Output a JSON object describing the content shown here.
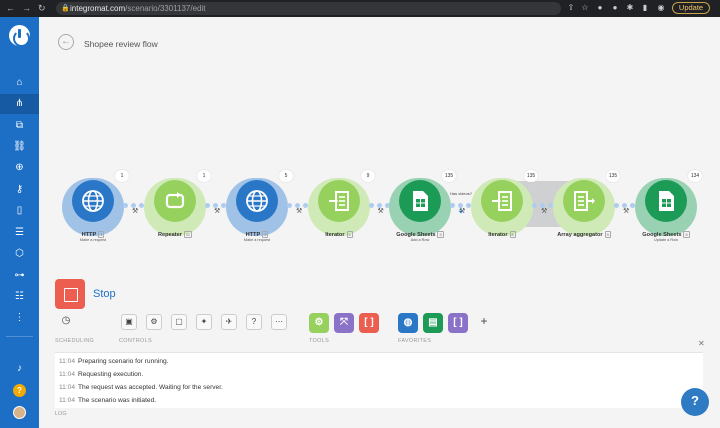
{
  "browser": {
    "url_host": "integromat.com",
    "url_path": "/scenario/3301137/edit",
    "update_label": "Update"
  },
  "header": {
    "title": "Shopee review flow"
  },
  "modules": [
    {
      "label": "HTTP",
      "num": "1",
      "sub": "Make a request",
      "count": "1",
      "color": "#2a77c8",
      "icon": "globe-icon"
    },
    {
      "label": "Repeater",
      "num": "11",
      "sub": "",
      "count": "1",
      "color": "#96d15e",
      "icon": "repeat-icon"
    },
    {
      "label": "HTTP",
      "num": "3",
      "sub": "Make a request",
      "count": "5",
      "color": "#2a77c8",
      "icon": "globe-icon"
    },
    {
      "label": "Iterator",
      "num": "4",
      "sub": "",
      "count": "9",
      "color": "#96d15e",
      "icon": "iterator-icon"
    },
    {
      "label": "Google Sheets",
      "num": "5",
      "sub": "Add a Row",
      "count": "135",
      "color": "#1c9b57",
      "icon": "sheet-icon"
    },
    {
      "label": "Iterator",
      "num": "8",
      "sub": "",
      "count": "135",
      "color": "#96d15e",
      "icon": "iterator-icon"
    },
    {
      "label": "Array aggregator",
      "num": "9",
      "sub": "",
      "count": "135",
      "color": "#96d15e",
      "icon": "aggregator-icon"
    },
    {
      "label": "Google Sheets",
      "num": "6",
      "sub": "Update a Row",
      "count": "134",
      "color": "#1c9b57",
      "icon": "sheet-icon"
    }
  ],
  "filter_note": "Has videos?",
  "run": {
    "stop_label": "Stop"
  },
  "toolbar": {
    "groups": [
      "SCHEDULING",
      "CONTROLS",
      "TOOLS",
      "FAVORITES"
    ],
    "tools_colors": [
      "#96d15e",
      "#8b72c9",
      "#ec5f50"
    ],
    "favorites_colors": [
      "#2a77c8",
      "#1c9b57",
      "#8b72c9"
    ]
  },
  "log": {
    "label": "LOG",
    "entries": [
      {
        "time": "11:04",
        "text": "Preparing scenario for running."
      },
      {
        "time": "11:04",
        "text": "Requesting execution."
      },
      {
        "time": "11:04",
        "text": "The request was accepted. Waiting for the server."
      },
      {
        "time": "11:04",
        "text": "The scenario was initiated."
      }
    ]
  }
}
